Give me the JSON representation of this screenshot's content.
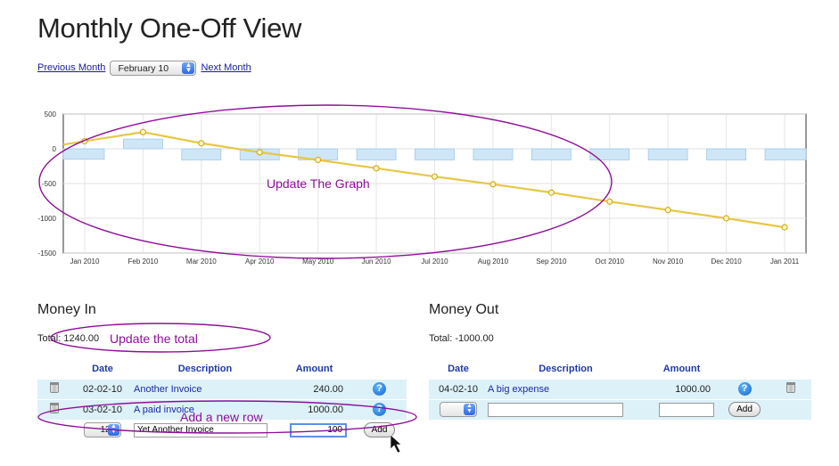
{
  "page": {
    "title": "Monthly One-Off View"
  },
  "nav": {
    "prev_label": "Previous Month",
    "month_value": "February 10",
    "next_label": "Next Month"
  },
  "chart_data": {
    "type": "bar",
    "categories": [
      "Jan 2010",
      "Feb 2010",
      "Mar 2010",
      "Apr 2010",
      "May 2010",
      "Jun 2010",
      "Jul 2010",
      "Aug 2010",
      "Sep 2010",
      "Oct 2010",
      "Nov 2010",
      "Dec 2010",
      "Jan 2011"
    ],
    "yticks": [
      500,
      0,
      -500,
      -1000,
      -1500
    ],
    "ylim": [
      -1500,
      500
    ],
    "grid": true,
    "series": [
      {
        "type": "bar",
        "values": [
          -150,
          140,
          -160,
          -160,
          -160,
          -160,
          -160,
          -160,
          -160,
          -160,
          -160,
          -160,
          -160
        ]
      },
      {
        "type": "line",
        "values": [
          110,
          240,
          80,
          -50,
          -160,
          -280,
          -400,
          -510,
          -630,
          -760,
          -880,
          -1000,
          -1130
        ]
      }
    ],
    "bar_color": "#cfe6f7",
    "line_color": "#e8c744",
    "line_extra_start": 60
  },
  "money_in": {
    "title": "Money In",
    "total": "Total: 1240.00",
    "headers": {
      "date": "Date",
      "description": "Description",
      "amount": "Amount"
    },
    "rows": [
      {
        "date": "02-02-10",
        "description": "Another Invoice",
        "amount": "240.00"
      },
      {
        "date": "03-02-10",
        "description": "A paid invoice",
        "amount": "1000.00"
      }
    ],
    "new_row": {
      "day": "12",
      "description": "Yet Another Invoice",
      "amount": "100",
      "add_label": "Add"
    }
  },
  "money_out": {
    "title": "Money Out",
    "total": "Total: -1000.00",
    "headers": {
      "date": "Date",
      "description": "Description",
      "amount": "Amount"
    },
    "rows": [
      {
        "date": "04-02-10",
        "description": "A big expense",
        "amount": "1000.00"
      }
    ],
    "new_row": {
      "day": "",
      "description": "",
      "amount": "",
      "add_label": "Add"
    }
  },
  "annotations": {
    "graph": "Update The Graph",
    "total": "Update the total",
    "row": "Add a new row"
  },
  "icons": {
    "help": "?",
    "trash": "trash-icon",
    "cursor": "arrow-cursor-icon"
  }
}
